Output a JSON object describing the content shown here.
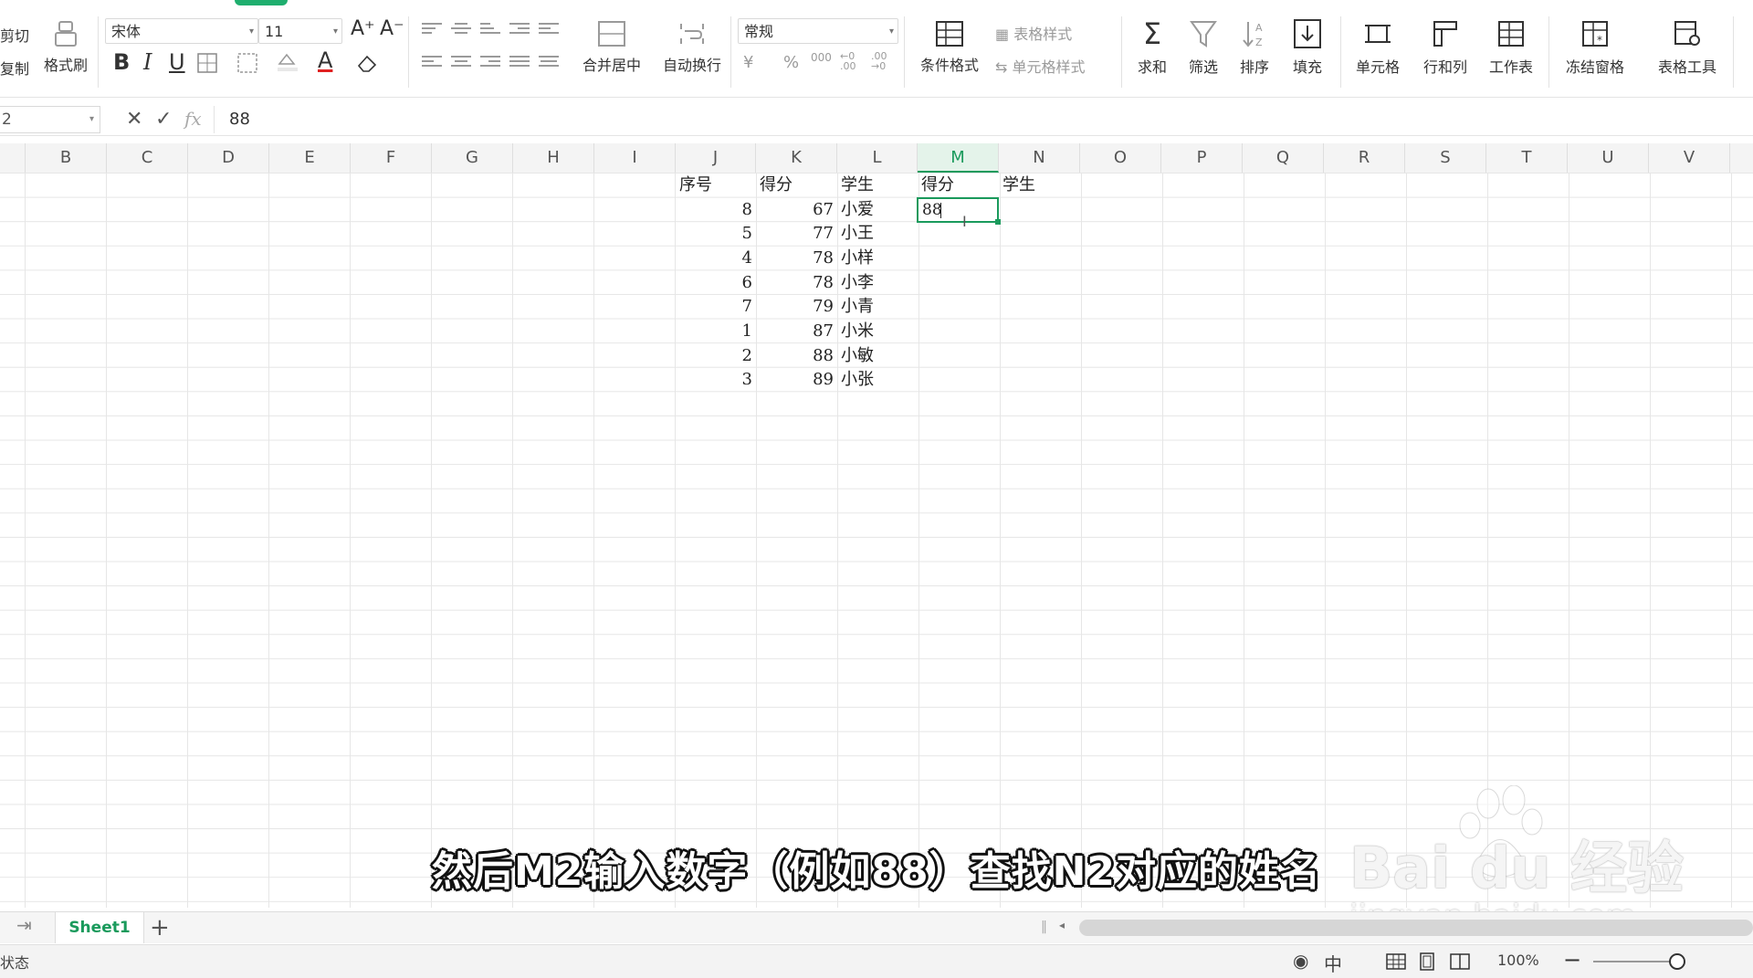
{
  "ribbon": {
    "clipboard": {
      "cut_label": "剪切",
      "copy_label": "复制",
      "format_painter_label": "格式刷"
    },
    "font": {
      "family": "宋体",
      "size": "11",
      "grow_label": "A⁺",
      "shrink_label": "A⁻"
    },
    "alignment": {
      "merge_center_label": "合并居中",
      "wrap_text_label": "自动换行"
    },
    "number": {
      "format": "常规",
      "currency": "¥",
      "percent": "%",
      "thousands": "000",
      "inc_decimal": "←0 .00",
      "dec_decimal": ".00 →0"
    },
    "styles": {
      "conditional_format_label": "条件格式",
      "table_style_label": "表格样式",
      "cell_style_label": "单元格样式"
    },
    "editing": {
      "sum_label": "求和",
      "filter_label": "筛选",
      "sort_label": "排序",
      "fill_label": "填充"
    },
    "cells": {
      "cell_label": "单元格",
      "row_col_label": "行和列",
      "worksheet_label": "工作表",
      "freeze_label": "冻结窗格",
      "table_tools_label": "表格工具"
    }
  },
  "formula_bar": {
    "cell_ref": "2",
    "value": "88",
    "fx_label": "fx"
  },
  "columns": [
    "B",
    "C",
    "D",
    "E",
    "F",
    "G",
    "H",
    "I",
    "J",
    "K",
    "L",
    "M",
    "N",
    "O",
    "P",
    "Q",
    "R",
    "S",
    "T",
    "U",
    "V"
  ],
  "active_column": "M",
  "table": {
    "headers": {
      "seq": "序号",
      "score": "得分",
      "student": "学生"
    },
    "rows": [
      {
        "seq": "8",
        "score": "67",
        "student": "小爱"
      },
      {
        "seq": "5",
        "score": "77",
        "student": "小王"
      },
      {
        "seq": "4",
        "score": "78",
        "student": "小样"
      },
      {
        "seq": "6",
        "score": "78",
        "student": "小李"
      },
      {
        "seq": "7",
        "score": "79",
        "student": "小青"
      },
      {
        "seq": "1",
        "score": "87",
        "student": "小米"
      },
      {
        "seq": "2",
        "score": "88",
        "student": "小敏"
      },
      {
        "seq": "3",
        "score": "89",
        "student": "小张"
      }
    ]
  },
  "lookup": {
    "score_header": "得分",
    "student_header": "学生",
    "input_value": "88"
  },
  "subtitle": "然后M2输入数字（例如88）查找N2对应的姓名",
  "watermark": {
    "brand": "Bai du 经验",
    "url": "jingyan.baidu.com"
  },
  "sheet_tabs": {
    "active": "Sheet1",
    "add_label": "+"
  },
  "status_bar": {
    "label": "状态",
    "zoom": "100%"
  },
  "colors": {
    "accent": "#1a9a5c",
    "font_color_red": "#e02020"
  }
}
